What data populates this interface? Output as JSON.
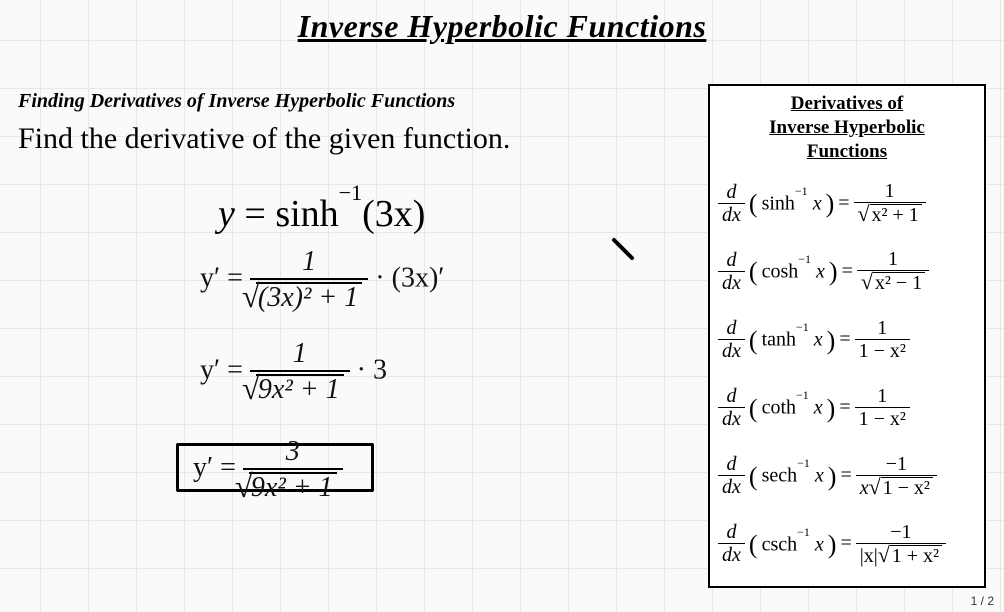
{
  "title": "Inverse Hyperbolic Functions",
  "subtitle": "Finding Derivatives of Inverse Hyperbolic Functions",
  "prompt": "Find the derivative of the given function.",
  "equation": {
    "lhs": "y",
    "fn": "sinh",
    "exp": "−1",
    "arg": "3x"
  },
  "work": {
    "line1": {
      "lhs": "y′ =",
      "num": "1",
      "den_inside": "(3x)² + 1",
      "tail": " · (3x)′"
    },
    "line2": {
      "lhs": "y′ =",
      "num": "1",
      "den_inside": "9x² + 1",
      "tail": " · 3"
    },
    "line3": {
      "lhs": "y′ =",
      "num": "3",
      "den_inside": "9x² + 1"
    }
  },
  "panel": {
    "title_l1": "Derivatives of",
    "title_l2": "Inverse Hyperbolic",
    "title_l3": "Functions",
    "rows": [
      {
        "fn": "sinh",
        "rhs_num": "1",
        "rhs_den_sqrt": "x² + 1",
        "rhs_den_plain": ""
      },
      {
        "fn": "cosh",
        "rhs_num": "1",
        "rhs_den_sqrt": "x² − 1",
        "rhs_den_plain": ""
      },
      {
        "fn": "tanh",
        "rhs_num": "1",
        "rhs_den_sqrt": "",
        "rhs_den_plain": "1 − x²"
      },
      {
        "fn": "coth",
        "rhs_num": "1",
        "rhs_den_sqrt": "",
        "rhs_den_plain": "1 − x²"
      },
      {
        "fn": "sech",
        "rhs_num": "−1",
        "rhs_den_sqrt": "1 − x²",
        "rhs_den_plain": "",
        "den_prefix": "x"
      },
      {
        "fn": "csch",
        "rhs_num": "−1",
        "rhs_den_sqrt": "1 + x²",
        "rhs_den_plain": "",
        "den_prefix": "|x|"
      }
    ]
  },
  "page": "1 / 2"
}
